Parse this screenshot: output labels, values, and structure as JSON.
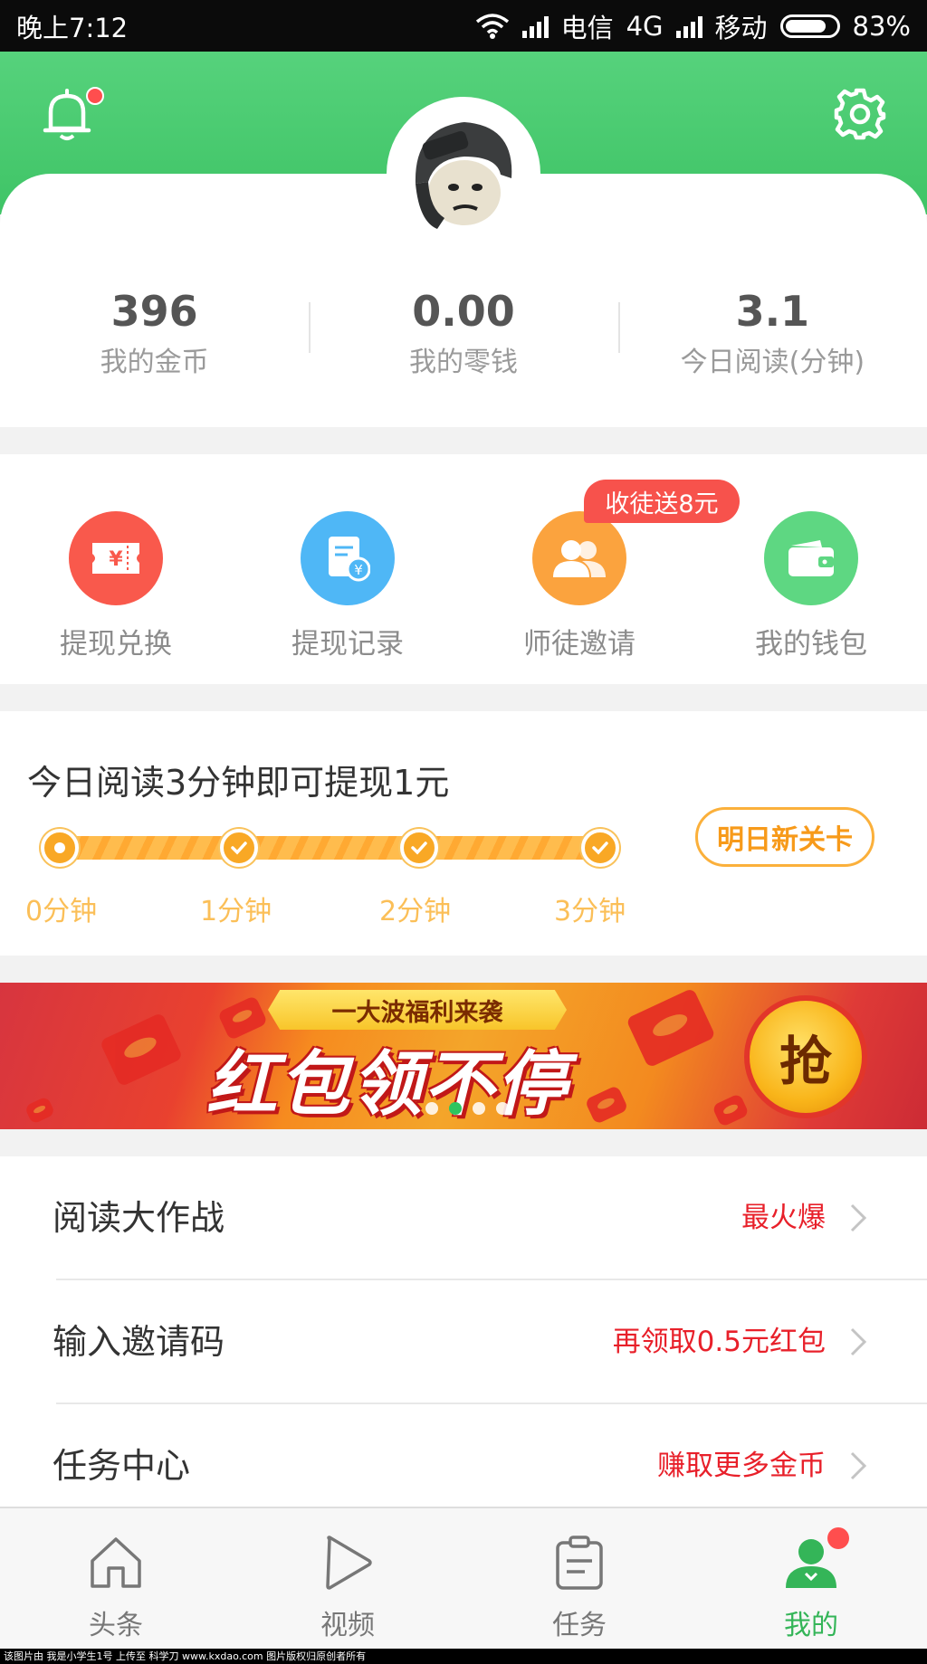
{
  "status_bar": {
    "time": "晚上7:12",
    "carrier1": "电信",
    "network": "4G",
    "carrier2": "移动",
    "battery": "83%"
  },
  "header": {
    "bell_icon": "bell-icon",
    "settings_icon": "gear-icon",
    "bell_has_notification": true,
    "brand_color": "#4cc973"
  },
  "stats": [
    {
      "value": "396",
      "label": "我的金币"
    },
    {
      "value": "0.00",
      "label": "我的零钱"
    },
    {
      "value": "3.1",
      "label": "今日阅读(分钟)"
    }
  ],
  "actions": [
    {
      "label": "提现兑换",
      "icon": "ticket-yen-icon",
      "color": "#f9594c"
    },
    {
      "label": "提现记录",
      "icon": "record-yen-icon",
      "color": "#4fb7f6"
    },
    {
      "label": "师徒邀请",
      "icon": "users-icon",
      "color": "#fba33e"
    },
    {
      "label": "我的钱包",
      "icon": "wallet-icon",
      "color": "#5ed782"
    }
  ],
  "invite_badge": "收徒送8元",
  "reading_task": {
    "title": "今日阅读3分钟即可提现1元",
    "milestones": [
      "0分钟",
      "1分钟",
      "2分钟",
      "3分钟"
    ],
    "next_button": "明日新关卡",
    "progress_fraction": 1.0
  },
  "banner": {
    "ribbon": "一大波福利来袭",
    "headline": "红包领不停",
    "grab_button": "抢",
    "active_dot": 1,
    "dot_count": 4
  },
  "menu": [
    {
      "name": "阅读大作战",
      "hint": "最火爆"
    },
    {
      "name": "输入邀请码",
      "hint": "再领取0.5元红包"
    },
    {
      "name": "任务中心",
      "hint": "赚取更多金币"
    }
  ],
  "tabbar": [
    {
      "label": "头条",
      "icon": "home-icon"
    },
    {
      "label": "视频",
      "icon": "play-icon"
    },
    {
      "label": "任务",
      "icon": "clipboard-icon"
    },
    {
      "label": "我的",
      "icon": "user-icon",
      "active": true
    }
  ],
  "footer": "该图片由 我是小学生1号 上传至 科学刀 www.kxdao.com 图片版权归原创者所有"
}
